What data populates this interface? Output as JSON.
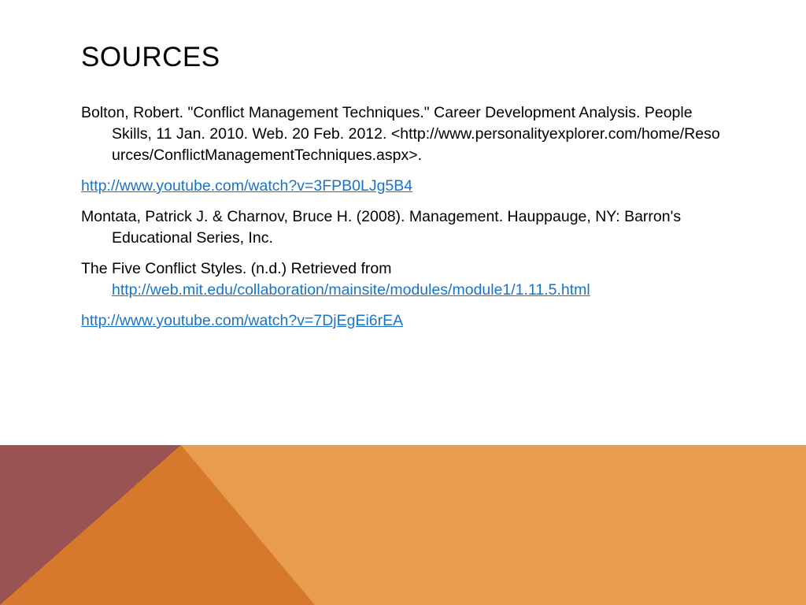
{
  "slide": {
    "title": "SOURCES"
  },
  "sources": {
    "bolton": {
      "text": "Bolton, Robert. \"Conflict Management Techniques.\" Career Development Analysis. People Skills, 11 Jan. 2010. Web. 20 Feb. 2012.",
      "url_text": "<http://www.personalityexplorer.com/home/Resources/ConflictManagementTechniques.aspx>."
    },
    "youtube_1": "http://www.youtube.com/watch?v=3FPB0LJg5B4",
    "montata": "Montata, Patrick J. & Charnov, Bruce H. (2008). Management. Hauppauge, NY: Barron's Educational Series, Inc.",
    "five_styles": {
      "text": "The Five Conflict Styles. (n.d.) Retrieved from",
      "link": "http://web.mit.edu/collaboration/mainsite/modules/module1/1.11.5.html"
    },
    "youtube_2": "http://www.youtube.com/watch?v=7DjEgEi6rEA"
  },
  "colors": {
    "band_light_orange": "#E89C4C",
    "band_dark_orange": "#D6792C",
    "band_maroon": "#9A5353",
    "link": "#1A73C8"
  }
}
